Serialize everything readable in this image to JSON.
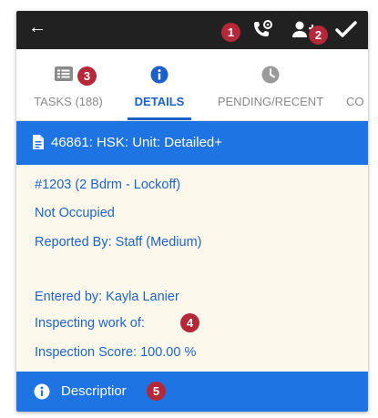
{
  "header": {
    "back_icon": "arrow-left-icon",
    "call_icon": "phone-settings-icon",
    "add_user_icon": "add-user-icon",
    "confirm_icon": "checkmark-icon"
  },
  "callouts": [
    "1",
    "2",
    "3",
    "4",
    "5"
  ],
  "tabs": [
    {
      "label": "TASKS (188)",
      "icon": "list-icon",
      "active": false
    },
    {
      "label": "DETAILS",
      "icon": "info-icon",
      "active": true
    },
    {
      "label": "PENDING/RECENT",
      "icon": "clock-icon",
      "active": false
    },
    {
      "label": "CO",
      "icon": "",
      "active": false
    }
  ],
  "card": {
    "icon": "document-icon",
    "title": "46861: HSK: Unit: Detailed+"
  },
  "details": {
    "unit": "#1203 (2 Bdrm - Lockoff)",
    "occupancy": "Not Occupied",
    "reported_by": "Reported By: Staff  (Medium)",
    "entered_by": "Entered by: Kayla Lanier",
    "inspecting": "Inspecting work of:",
    "score": "Inspection Score: 100.00 %"
  },
  "description": {
    "icon": "info-icon",
    "label": "Descriptior"
  },
  "colors": {
    "topbar": "#212121",
    "accent_blue": "#1d74e2",
    "active_tab": "#1b61c9",
    "content_bg": "#fdf8ec",
    "badge": "#b5283a"
  }
}
